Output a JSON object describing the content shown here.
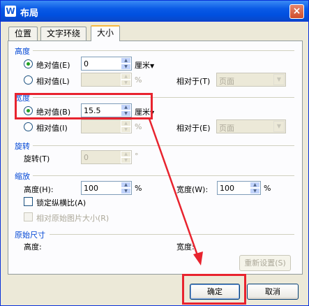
{
  "window": {
    "title": "布局",
    "icon": "W",
    "close": "×"
  },
  "tabs": [
    {
      "label": "位置",
      "active": false
    },
    {
      "label": "文字环绕",
      "active": false
    },
    {
      "label": "大小",
      "active": true
    }
  ],
  "height": {
    "section": "高度",
    "absolute_label": "绝对值(E)",
    "absolute_value": "0",
    "absolute_unit": "厘米",
    "relative_label": "相对值(L)",
    "relative_value": "",
    "relative_unit": "%",
    "relative_to_label": "相对于(T)",
    "relative_to_value": "页面"
  },
  "width": {
    "section": "宽度",
    "absolute_label": "绝对值(B)",
    "absolute_value": "15.5",
    "absolute_unit": "厘米",
    "relative_label": "相对值(I)",
    "relative_value": "",
    "relative_unit": "%",
    "relative_to_label": "相对于(E)",
    "relative_to_value": "页面"
  },
  "rotate": {
    "section": "旋转",
    "label": "旋转(T)",
    "value": "0",
    "unit": "°"
  },
  "scale": {
    "section": "缩放",
    "height_label": "高度(H):",
    "height_value": "100",
    "height_unit": "%",
    "width_label": "宽度(W):",
    "width_value": "100",
    "width_unit": "%",
    "lock_aspect_label": "锁定纵横比(A)",
    "relative_original_label": "相对原始图片大小(R)"
  },
  "original": {
    "section": "原始尺寸",
    "height_label": "高度:",
    "width_label": "宽度:",
    "reset_label": "重新设置(S)"
  },
  "buttons": {
    "ok": "确定",
    "cancel": "取消"
  },
  "colors": {
    "highlight": "#e8232e",
    "section_title": "#0046d5"
  }
}
